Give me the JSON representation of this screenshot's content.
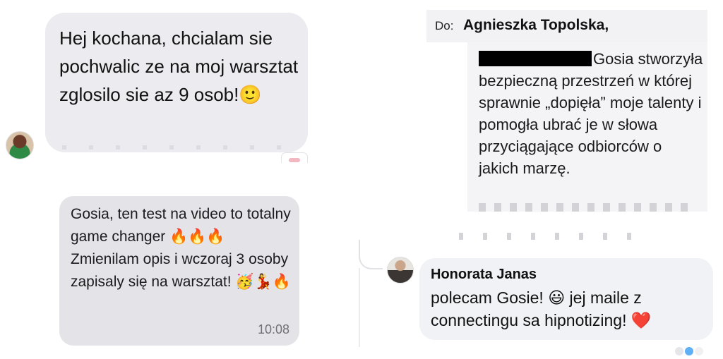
{
  "message1": {
    "text": "Hej kochana, chcialam sie pochwalic ze na moj warsztat zglosilo sie az 9 osob!🙂"
  },
  "message2": {
    "text_line1": "Gosia, ten test na video to totalny game changer 🔥🔥🔥",
    "text_line2": "Zmienilam opis i wczoraj 3 osoby zapisaly się na warsztat! 🥳💃🔥",
    "time": "10:08"
  },
  "email": {
    "to_label": "Do:",
    "to_name": "Agnieszka Topolska,",
    "body": "Gosia stworzyła bezpieczną przestrzeń w której sprawnie „dopięła” moje talenty i pomogła ubrać je w słowa przyciągające odbiorców o jakich marzę."
  },
  "comment": {
    "author": "Honorata Janas",
    "text": "polecam Gosie! 😃  jej maile z connectingu sa hipnotizing! ❤️"
  },
  "colors": {
    "bubble_light": "#ebebf0",
    "bubble_grey": "#e4e4e8",
    "comment_bg": "#f0f2f5",
    "redaction": "#000000"
  }
}
